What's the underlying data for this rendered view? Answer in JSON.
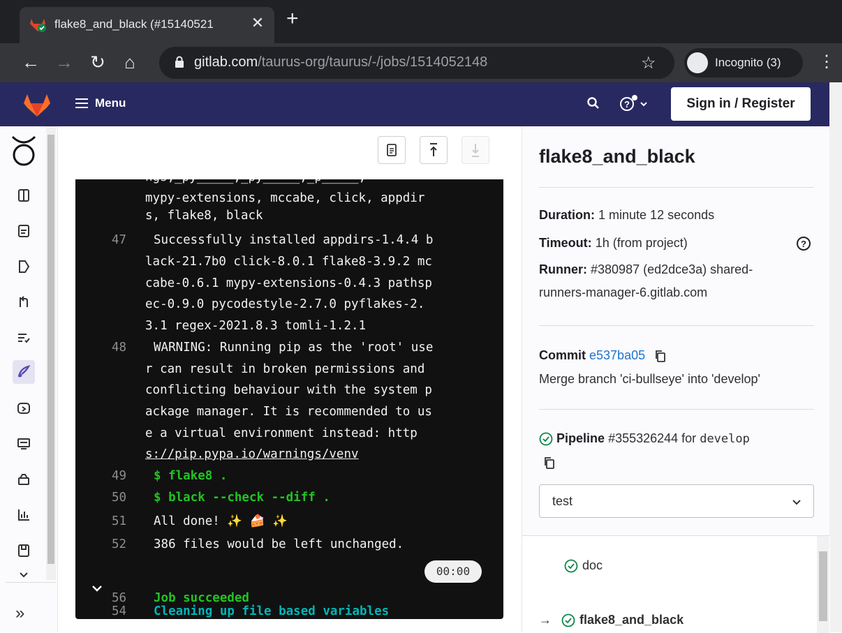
{
  "browser": {
    "tab_title": "flake8_and_black (#15140521",
    "url_host": "gitlab.com",
    "url_path": "/taurus-org/taurus/-/jobs/1514052148",
    "incognito_label": "Incognito (3)"
  },
  "header": {
    "menu_label": "Menu",
    "signin_label": "Sign in / Register"
  },
  "log": {
    "lines": [
      {
        "num": "",
        "text": "mypy-extensions, mccabe, click, appdir",
        "style": "plain"
      },
      {
        "num": "",
        "text": "s, flake8, black",
        "style": "plain"
      },
      {
        "num": "47",
        "text": "Successfully installed appdirs-1.4.4 b",
        "style": "plain"
      },
      {
        "num": "",
        "text": "lack-21.7b0 click-8.0.1 flake8-3.9.2 mc",
        "style": "plain"
      },
      {
        "num": "",
        "text": "cabe-0.6.1 mypy-extensions-0.4.3 pathsp",
        "style": "plain"
      },
      {
        "num": "",
        "text": "ec-0.9.0 pycodestyle-2.7.0 pyflakes-2.",
        "style": "plain"
      },
      {
        "num": "",
        "text": "3.1 regex-2021.8.3 tomli-1.2.1",
        "style": "plain"
      },
      {
        "num": "48",
        "text": "WARNING: Running pip as the 'root' use",
        "style": "plain"
      },
      {
        "num": "",
        "text": "r can result in broken permissions and",
        "style": "plain"
      },
      {
        "num": "",
        "text": "conflicting behaviour with the system p",
        "style": "plain"
      },
      {
        "num": "",
        "text": "ackage manager. It is recommended to us",
        "style": "plain"
      },
      {
        "num": "",
        "text": "e a virtual environment instead: http",
        "style": "plain"
      },
      {
        "num": "",
        "text": "s://pip.pypa.io/warnings/venv",
        "style": "link"
      },
      {
        "num": "49",
        "text": "$ flake8 .",
        "style": "green"
      },
      {
        "num": "50",
        "text": "$ black --check --diff .",
        "style": "green"
      },
      {
        "num": "51",
        "text": "All done! ✨ 🍰 ✨",
        "style": "plain"
      },
      {
        "num": "52",
        "text": "386 files would be left unchanged.",
        "style": "plain"
      },
      {
        "num": "54",
        "text": "Cleaning up file based variables",
        "style": "cyan"
      },
      {
        "num": "56",
        "text": "Job succeeded",
        "style": "green"
      }
    ],
    "section_duration": "00:00"
  },
  "job": {
    "title": "flake8_and_black",
    "duration_label": "Duration:",
    "duration_value": "1 minute 12 seconds",
    "timeout_label": "Timeout:",
    "timeout_value": "1h (from project)",
    "runner_label": "Runner:",
    "runner_value_1": "#380987 (ed2dce3a) shared-",
    "runner_value_2": "runners-manager-6.gitlab.com",
    "commit_label": "Commit",
    "commit_sha": "e537ba05",
    "commit_message": "Merge branch 'ci-bullseye' into 'develop'",
    "pipeline_label": "Pipeline",
    "pipeline_id": "#355326244 for",
    "pipeline_ref": "develop",
    "stage_selected": "test",
    "jobs": [
      {
        "name": "doc",
        "current": false
      },
      {
        "name": "flake8_and_black",
        "current": true
      }
    ]
  },
  "colors": {
    "header_bg": "#292961",
    "log_bg": "#111111",
    "success": "#108548",
    "link": "#1f75cb"
  }
}
